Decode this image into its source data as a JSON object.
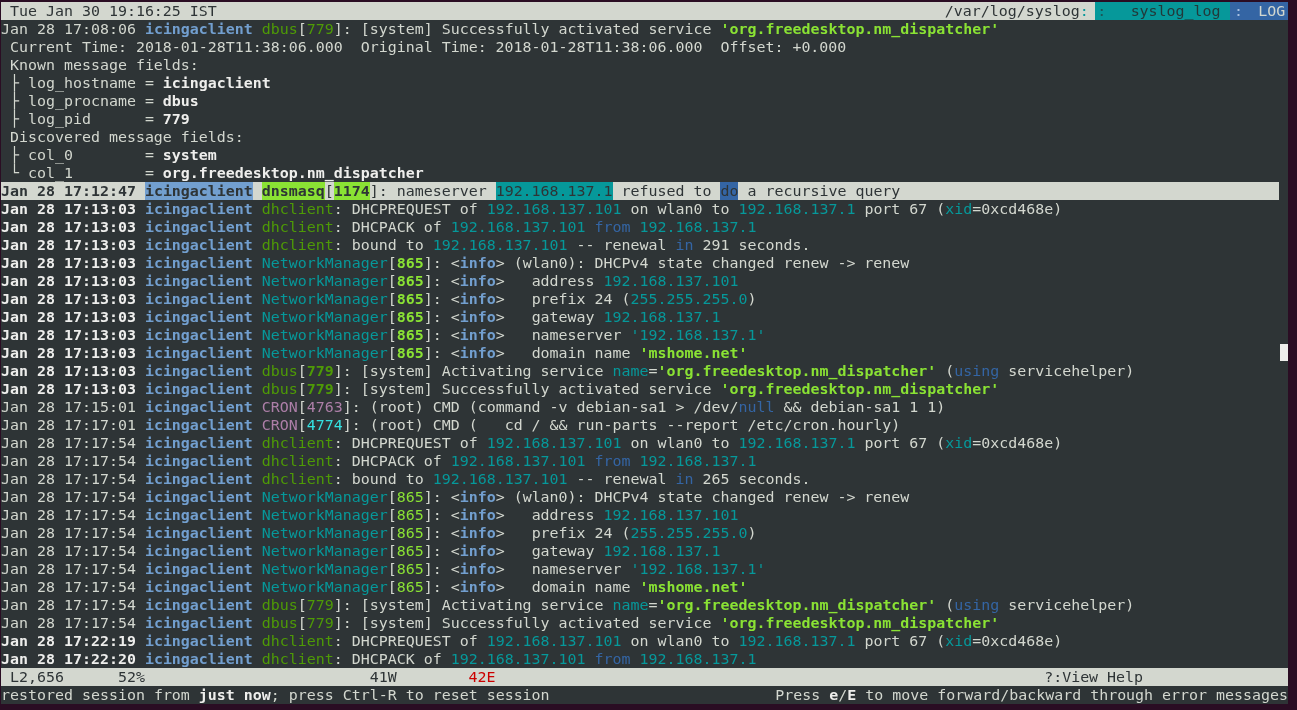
{
  "title_bar": {
    "clock": "Tue Jan 30 19:16:25 IST",
    "file": {
      "path": "/var/log/syslog",
      "sep": ":"
    },
    "format": {
      "sep": ":",
      "text": "syslog_log"
    },
    "view": {
      "sep": ":",
      "text": "LOG"
    }
  },
  "detail": {
    "line": {
      "emphasized": false,
      "spans": [
        {
          "kind": "time",
          "text": "Jan 28 17:08:06"
        },
        {
          "kind": "host",
          "text": "icingaclient"
        },
        {
          "kind": "proc",
          "text": "dbus",
          "color": "#4e9a06"
        },
        {
          "kind": "text",
          "text": "["
        },
        {
          "kind": "pid",
          "text": "779",
          "color": "#4e9a06"
        },
        {
          "kind": "text",
          "text": "]: [system] Successfully activated service "
        },
        {
          "kind": "string",
          "text": "'org.freedesktop.nm_dispatcher'"
        }
      ]
    },
    "times": "Current Time: 2018-01-28T11:38:06.000  Original Time: 2018-01-28T11:38:06.000  Offset: +0.000",
    "sections": [
      {
        "title": "Known message fields:",
        "fields": [
          {
            "branch": "├",
            "name": "log_hostname",
            "op": "=",
            "value": "icingaclient"
          },
          {
            "branch": "├",
            "name": "log_procname",
            "op": "=",
            "value": "dbus"
          },
          {
            "branch": "├",
            "name": "log_pid",
            "op": "=",
            "value": "779"
          }
        ]
      },
      {
        "title": "Discovered message fields:",
        "fields": [
          {
            "branch": "├",
            "name": "col_0",
            "op": "=",
            "value": "system"
          },
          {
            "branch": "└",
            "name": "col_1",
            "op": "=",
            "value": "org.freedesktop.nm_dispatcher"
          }
        ]
      }
    ]
  },
  "log_lines": [
    {
      "selected": true,
      "emphasized": true,
      "spans": [
        {
          "kind": "time",
          "text": "Jan 28 17:12:47"
        },
        {
          "kind": "host",
          "text": "icingaclient"
        },
        {
          "kind": "proc",
          "text": "dnsmasq",
          "color": "#8ae234"
        },
        {
          "kind": "text",
          "text": "["
        },
        {
          "kind": "pid",
          "text": "1174",
          "color": "#8ae234"
        },
        {
          "kind": "text",
          "text": "]: nameserver "
        },
        {
          "kind": "ip",
          "text": "192.168.137.1"
        },
        {
          "kind": "text",
          "text": " refused to "
        },
        {
          "kind": "keyword",
          "text": "do"
        },
        {
          "kind": "text",
          "text": " a recursive query"
        }
      ]
    },
    {
      "selected": false,
      "emphasized": true,
      "spans": [
        {
          "kind": "time",
          "text": "Jan 28 17:13:03"
        },
        {
          "kind": "host",
          "text": "icingaclient"
        },
        {
          "kind": "proc",
          "text": "dhclient",
          "color": "#4e9a06"
        },
        {
          "kind": "text",
          "text": ": DHCPREQUEST of "
        },
        {
          "kind": "ip",
          "text": "192.168.137.101"
        },
        {
          "kind": "text",
          "text": " on wlan0 to "
        },
        {
          "kind": "ip",
          "text": "192.168.137.1"
        },
        {
          "kind": "text",
          "text": " port 67 ("
        },
        {
          "kind": "symbol",
          "text": "xid"
        },
        {
          "kind": "text",
          "text": "=0xcd468e)"
        }
      ]
    },
    {
      "selected": false,
      "emphasized": true,
      "spans": [
        {
          "kind": "time",
          "text": "Jan 28 17:13:03"
        },
        {
          "kind": "host",
          "text": "icingaclient"
        },
        {
          "kind": "proc",
          "text": "dhclient",
          "color": "#4e9a06"
        },
        {
          "kind": "text",
          "text": ": DHCPACK of "
        },
        {
          "kind": "ip",
          "text": "192.168.137.101"
        },
        {
          "kind": "keyword",
          "text": " from "
        },
        {
          "kind": "ip",
          "text": "192.168.137.1"
        }
      ]
    },
    {
      "selected": false,
      "emphasized": true,
      "spans": [
        {
          "kind": "time",
          "text": "Jan 28 17:13:03"
        },
        {
          "kind": "host",
          "text": "icingaclient"
        },
        {
          "kind": "proc",
          "text": "dhclient",
          "color": "#4e9a06"
        },
        {
          "kind": "text",
          "text": ": bound to "
        },
        {
          "kind": "ip",
          "text": "192.168.137.101"
        },
        {
          "kind": "text",
          "text": " -- renewal "
        },
        {
          "kind": "keyword",
          "text": "in"
        },
        {
          "kind": "text",
          "text": " 291 seconds."
        }
      ]
    },
    {
      "selected": false,
      "emphasized": true,
      "spans": [
        {
          "kind": "time",
          "text": "Jan 28 17:13:03"
        },
        {
          "kind": "host",
          "text": "icingaclient"
        },
        {
          "kind": "proc",
          "text": "NetworkManager",
          "color": "#06989a"
        },
        {
          "kind": "text",
          "text": "["
        },
        {
          "kind": "pid",
          "text": "865",
          "color": "#8ae234"
        },
        {
          "kind": "text",
          "text": "]: <"
        },
        {
          "kind": "tag",
          "text": "info"
        },
        {
          "kind": "text",
          "text": "> (wlan0): DHCPv4 state changed renew -> renew"
        }
      ]
    },
    {
      "selected": false,
      "emphasized": true,
      "spans": [
        {
          "kind": "time",
          "text": "Jan 28 17:13:03"
        },
        {
          "kind": "host",
          "text": "icingaclient"
        },
        {
          "kind": "proc",
          "text": "NetworkManager",
          "color": "#06989a"
        },
        {
          "kind": "text",
          "text": "["
        },
        {
          "kind": "pid",
          "text": "865",
          "color": "#8ae234"
        },
        {
          "kind": "text",
          "text": "]: <"
        },
        {
          "kind": "tag",
          "text": "info"
        },
        {
          "kind": "text",
          "text": ">   address "
        },
        {
          "kind": "ip",
          "text": "192.168.137.101"
        }
      ]
    },
    {
      "selected": false,
      "emphasized": true,
      "spans": [
        {
          "kind": "time",
          "text": "Jan 28 17:13:03"
        },
        {
          "kind": "host",
          "text": "icingaclient"
        },
        {
          "kind": "proc",
          "text": "NetworkManager",
          "color": "#06989a"
        },
        {
          "kind": "text",
          "text": "["
        },
        {
          "kind": "pid",
          "text": "865",
          "color": "#8ae234"
        },
        {
          "kind": "text",
          "text": "]: <"
        },
        {
          "kind": "tag",
          "text": "info"
        },
        {
          "kind": "text",
          "text": ">   prefix 24 ("
        },
        {
          "kind": "ip",
          "text": "255.255.255.0"
        },
        {
          "kind": "text",
          "text": ")"
        }
      ]
    },
    {
      "selected": false,
      "emphasized": true,
      "spans": [
        {
          "kind": "time",
          "text": "Jan 28 17:13:03"
        },
        {
          "kind": "host",
          "text": "icingaclient"
        },
        {
          "kind": "proc",
          "text": "NetworkManager",
          "color": "#06989a"
        },
        {
          "kind": "text",
          "text": "["
        },
        {
          "kind": "pid",
          "text": "865",
          "color": "#8ae234"
        },
        {
          "kind": "text",
          "text": "]: <"
        },
        {
          "kind": "tag",
          "text": "info"
        },
        {
          "kind": "text",
          "text": ">   gateway "
        },
        {
          "kind": "ip",
          "text": "192.168.137.1"
        }
      ]
    },
    {
      "selected": false,
      "emphasized": true,
      "spans": [
        {
          "kind": "time",
          "text": "Jan 28 17:13:03"
        },
        {
          "kind": "host",
          "text": "icingaclient"
        },
        {
          "kind": "proc",
          "text": "NetworkManager",
          "color": "#06989a"
        },
        {
          "kind": "text",
          "text": "["
        },
        {
          "kind": "pid",
          "text": "865",
          "color": "#8ae234"
        },
        {
          "kind": "text",
          "text": "]: <"
        },
        {
          "kind": "tag",
          "text": "info"
        },
        {
          "kind": "text",
          "text": ">   nameserver "
        },
        {
          "kind": "ip",
          "text": "'192.168.137.1'"
        }
      ]
    },
    {
      "selected": false,
      "emphasized": true,
      "spans": [
        {
          "kind": "time",
          "text": "Jan 28 17:13:03"
        },
        {
          "kind": "host",
          "text": "icingaclient"
        },
        {
          "kind": "proc",
          "text": "NetworkManager",
          "color": "#06989a"
        },
        {
          "kind": "text",
          "text": "["
        },
        {
          "kind": "pid",
          "text": "865",
          "color": "#8ae234"
        },
        {
          "kind": "text",
          "text": "]: <"
        },
        {
          "kind": "tag",
          "text": "info"
        },
        {
          "kind": "text",
          "text": ">   domain name "
        },
        {
          "kind": "string",
          "text": "'mshome.net'"
        }
      ]
    },
    {
      "selected": false,
      "emphasized": true,
      "spans": [
        {
          "kind": "time",
          "text": "Jan 28 17:13:03"
        },
        {
          "kind": "host",
          "text": "icingaclient"
        },
        {
          "kind": "proc",
          "text": "dbus",
          "color": "#4e9a06"
        },
        {
          "kind": "text",
          "text": "["
        },
        {
          "kind": "pid",
          "text": "779",
          "color": "#4e9a06"
        },
        {
          "kind": "text",
          "text": "]: [system] Activating service "
        },
        {
          "kind": "symbol",
          "text": "name"
        },
        {
          "kind": "text",
          "text": "="
        },
        {
          "kind": "string",
          "text": "'org.freedesktop.nm_dispatcher'"
        },
        {
          "kind": "text",
          "text": " ("
        },
        {
          "kind": "keyword",
          "text": "using"
        },
        {
          "kind": "text",
          "text": " servicehelper)"
        }
      ]
    },
    {
      "selected": false,
      "emphasized": true,
      "spans": [
        {
          "kind": "time",
          "text": "Jan 28 17:13:03"
        },
        {
          "kind": "host",
          "text": "icingaclient"
        },
        {
          "kind": "proc",
          "text": "dbus",
          "color": "#4e9a06"
        },
        {
          "kind": "text",
          "text": "["
        },
        {
          "kind": "pid",
          "text": "779",
          "color": "#4e9a06"
        },
        {
          "kind": "text",
          "text": "]: [system] Successfully activated service "
        },
        {
          "kind": "string",
          "text": "'org.freedesktop.nm_dispatcher'"
        }
      ]
    },
    {
      "selected": false,
      "emphasized": false,
      "spans": [
        {
          "kind": "time",
          "text": "Jan 28 17:15:01"
        },
        {
          "kind": "host",
          "text": "icingaclient"
        },
        {
          "kind": "proc",
          "text": "CRON",
          "color": "#ad7fa8"
        },
        {
          "kind": "text",
          "text": "["
        },
        {
          "kind": "pid",
          "text": "4763",
          "color": "#ad7fa8"
        },
        {
          "kind": "text",
          "text": "]: (root) CMD (command -v debian-sa1 > /dev/"
        },
        {
          "kind": "keyword",
          "text": "null"
        },
        {
          "kind": "text",
          "text": " && debian-sa1 1 1)"
        }
      ]
    },
    {
      "selected": false,
      "emphasized": false,
      "spans": [
        {
          "kind": "time",
          "text": "Jan 28 17:17:01"
        },
        {
          "kind": "host",
          "text": "icingaclient"
        },
        {
          "kind": "proc",
          "text": "CRON",
          "color": "#ad7fa8"
        },
        {
          "kind": "text",
          "text": "["
        },
        {
          "kind": "pid",
          "text": "4774",
          "color": "#34e2e2"
        },
        {
          "kind": "text",
          "text": "]: (root) CMD (   cd / && run-parts --report /etc/cron.hourly)"
        }
      ]
    },
    {
      "selected": false,
      "emphasized": false,
      "spans": [
        {
          "kind": "time",
          "text": "Jan 28 17:17:54"
        },
        {
          "kind": "host",
          "text": "icingaclient"
        },
        {
          "kind": "proc",
          "text": "dhclient",
          "color": "#4e9a06"
        },
        {
          "kind": "text",
          "text": ": DHCPREQUEST of "
        },
        {
          "kind": "ip",
          "text": "192.168.137.101"
        },
        {
          "kind": "text",
          "text": " on wlan0 to "
        },
        {
          "kind": "ip",
          "text": "192.168.137.1"
        },
        {
          "kind": "text",
          "text": " port 67 ("
        },
        {
          "kind": "symbol",
          "text": "xid"
        },
        {
          "kind": "text",
          "text": "=0xcd468e)"
        }
      ]
    },
    {
      "selected": false,
      "emphasized": false,
      "spans": [
        {
          "kind": "time",
          "text": "Jan 28 17:17:54"
        },
        {
          "kind": "host",
          "text": "icingaclient"
        },
        {
          "kind": "proc",
          "text": "dhclient",
          "color": "#4e9a06"
        },
        {
          "kind": "text",
          "text": ": DHCPACK of "
        },
        {
          "kind": "ip",
          "text": "192.168.137.101"
        },
        {
          "kind": "keyword",
          "text": " from "
        },
        {
          "kind": "ip",
          "text": "192.168.137.1"
        }
      ]
    },
    {
      "selected": false,
      "emphasized": false,
      "spans": [
        {
          "kind": "time",
          "text": "Jan 28 17:17:54"
        },
        {
          "kind": "host",
          "text": "icingaclient"
        },
        {
          "kind": "proc",
          "text": "dhclient",
          "color": "#4e9a06"
        },
        {
          "kind": "text",
          "text": ": bound to "
        },
        {
          "kind": "ip",
          "text": "192.168.137.101"
        },
        {
          "kind": "text",
          "text": " -- renewal "
        },
        {
          "kind": "keyword",
          "text": "in"
        },
        {
          "kind": "text",
          "text": " 265 seconds."
        }
      ]
    },
    {
      "selected": false,
      "emphasized": false,
      "spans": [
        {
          "kind": "time",
          "text": "Jan 28 17:17:54"
        },
        {
          "kind": "host",
          "text": "icingaclient"
        },
        {
          "kind": "proc",
          "text": "NetworkManager",
          "color": "#06989a"
        },
        {
          "kind": "text",
          "text": "["
        },
        {
          "kind": "pid",
          "text": "865",
          "color": "#8ae234"
        },
        {
          "kind": "text",
          "text": "]: <"
        },
        {
          "kind": "tag",
          "text": "info"
        },
        {
          "kind": "text",
          "text": "> (wlan0): DHCPv4 state changed renew -> renew"
        }
      ]
    },
    {
      "selected": false,
      "emphasized": false,
      "spans": [
        {
          "kind": "time",
          "text": "Jan 28 17:17:54"
        },
        {
          "kind": "host",
          "text": "icingaclient"
        },
        {
          "kind": "proc",
          "text": "NetworkManager",
          "color": "#06989a"
        },
        {
          "kind": "text",
          "text": "["
        },
        {
          "kind": "pid",
          "text": "865",
          "color": "#8ae234"
        },
        {
          "kind": "text",
          "text": "]: <"
        },
        {
          "kind": "tag",
          "text": "info"
        },
        {
          "kind": "text",
          "text": ">   address "
        },
        {
          "kind": "ip",
          "text": "192.168.137.101"
        }
      ]
    },
    {
      "selected": false,
      "emphasized": false,
      "spans": [
        {
          "kind": "time",
          "text": "Jan 28 17:17:54"
        },
        {
          "kind": "host",
          "text": "icingaclient"
        },
        {
          "kind": "proc",
          "text": "NetworkManager",
          "color": "#06989a"
        },
        {
          "kind": "text",
          "text": "["
        },
        {
          "kind": "pid",
          "text": "865",
          "color": "#8ae234"
        },
        {
          "kind": "text",
          "text": "]: <"
        },
        {
          "kind": "tag",
          "text": "info"
        },
        {
          "kind": "text",
          "text": ">   prefix 24 ("
        },
        {
          "kind": "ip",
          "text": "255.255.255.0"
        },
        {
          "kind": "text",
          "text": ")"
        }
      ]
    },
    {
      "selected": false,
      "emphasized": false,
      "spans": [
        {
          "kind": "time",
          "text": "Jan 28 17:17:54"
        },
        {
          "kind": "host",
          "text": "icingaclient"
        },
        {
          "kind": "proc",
          "text": "NetworkManager",
          "color": "#06989a"
        },
        {
          "kind": "text",
          "text": "["
        },
        {
          "kind": "pid",
          "text": "865",
          "color": "#8ae234"
        },
        {
          "kind": "text",
          "text": "]: <"
        },
        {
          "kind": "tag",
          "text": "info"
        },
        {
          "kind": "text",
          "text": ">   gateway "
        },
        {
          "kind": "ip",
          "text": "192.168.137.1"
        }
      ]
    },
    {
      "selected": false,
      "emphasized": false,
      "spans": [
        {
          "kind": "time",
          "text": "Jan 28 17:17:54"
        },
        {
          "kind": "host",
          "text": "icingaclient"
        },
        {
          "kind": "proc",
          "text": "NetworkManager",
          "color": "#06989a"
        },
        {
          "kind": "text",
          "text": "["
        },
        {
          "kind": "pid",
          "text": "865",
          "color": "#8ae234"
        },
        {
          "kind": "text",
          "text": "]: <"
        },
        {
          "kind": "tag",
          "text": "info"
        },
        {
          "kind": "text",
          "text": ">   nameserver "
        },
        {
          "kind": "ip",
          "text": "'192.168.137.1'"
        }
      ]
    },
    {
      "selected": false,
      "emphasized": false,
      "spans": [
        {
          "kind": "time",
          "text": "Jan 28 17:17:54"
        },
        {
          "kind": "host",
          "text": "icingaclient"
        },
        {
          "kind": "proc",
          "text": "NetworkManager",
          "color": "#06989a"
        },
        {
          "kind": "text",
          "text": "["
        },
        {
          "kind": "pid",
          "text": "865",
          "color": "#8ae234"
        },
        {
          "kind": "text",
          "text": "]: <"
        },
        {
          "kind": "tag",
          "text": "info"
        },
        {
          "kind": "text",
          "text": ">   domain name "
        },
        {
          "kind": "string",
          "text": "'mshome.net'"
        }
      ]
    },
    {
      "selected": false,
      "emphasized": false,
      "spans": [
        {
          "kind": "time",
          "text": "Jan 28 17:17:54"
        },
        {
          "kind": "host",
          "text": "icingaclient"
        },
        {
          "kind": "proc",
          "text": "dbus",
          "color": "#4e9a06"
        },
        {
          "kind": "text",
          "text": "["
        },
        {
          "kind": "pid",
          "text": "779",
          "color": "#4e9a06"
        },
        {
          "kind": "text",
          "text": "]: [system] Activating service "
        },
        {
          "kind": "symbol",
          "text": "name"
        },
        {
          "kind": "text",
          "text": "="
        },
        {
          "kind": "string",
          "text": "'org.freedesktop.nm_dispatcher'"
        },
        {
          "kind": "text",
          "text": " ("
        },
        {
          "kind": "keyword",
          "text": "using"
        },
        {
          "kind": "text",
          "text": " servicehelper)"
        }
      ]
    },
    {
      "selected": false,
      "emphasized": false,
      "spans": [
        {
          "kind": "time",
          "text": "Jan 28 17:17:54"
        },
        {
          "kind": "host",
          "text": "icingaclient"
        },
        {
          "kind": "proc",
          "text": "dbus",
          "color": "#4e9a06"
        },
        {
          "kind": "text",
          "text": "["
        },
        {
          "kind": "pid",
          "text": "779",
          "color": "#4e9a06"
        },
        {
          "kind": "text",
          "text": "]: [system] Successfully activated service "
        },
        {
          "kind": "string",
          "text": "'org.freedesktop.nm_dispatcher'"
        }
      ]
    },
    {
      "selected": false,
      "emphasized": true,
      "spans": [
        {
          "kind": "time",
          "text": "Jan 28 17:22:19"
        },
        {
          "kind": "host",
          "text": "icingaclient"
        },
        {
          "kind": "proc",
          "text": "dhclient",
          "color": "#4e9a06"
        },
        {
          "kind": "text",
          "text": ": DHCPREQUEST of "
        },
        {
          "kind": "ip",
          "text": "192.168.137.101"
        },
        {
          "kind": "text",
          "text": " on wlan0 to "
        },
        {
          "kind": "ip",
          "text": "192.168.137.1"
        },
        {
          "kind": "text",
          "text": " port 67 ("
        },
        {
          "kind": "symbol",
          "text": "xid"
        },
        {
          "kind": "text",
          "text": "=0xcd468e)"
        }
      ]
    },
    {
      "selected": false,
      "emphasized": true,
      "spans": [
        {
          "kind": "time",
          "text": "Jan 28 17:22:20"
        },
        {
          "kind": "host",
          "text": "icingaclient"
        },
        {
          "kind": "proc",
          "text": "dhclient",
          "color": "#4e9a06"
        },
        {
          "kind": "text",
          "text": ": DHCPACK of "
        },
        {
          "kind": "ip",
          "text": "192.168.137.101"
        },
        {
          "kind": "keyword",
          "text": " from "
        },
        {
          "kind": "ip",
          "text": "192.168.137.1"
        }
      ]
    }
  ],
  "status_bar": {
    "line": "L2,656",
    "percent": "52%",
    "warnings": "41W",
    "errors": "42E",
    "help": "?:View Help"
  },
  "message_bar": {
    "left": "restored session from **just now**; press Ctrl-R to reset session",
    "right": "Press **e**/**E** to move forward/backward through error messages"
  }
}
